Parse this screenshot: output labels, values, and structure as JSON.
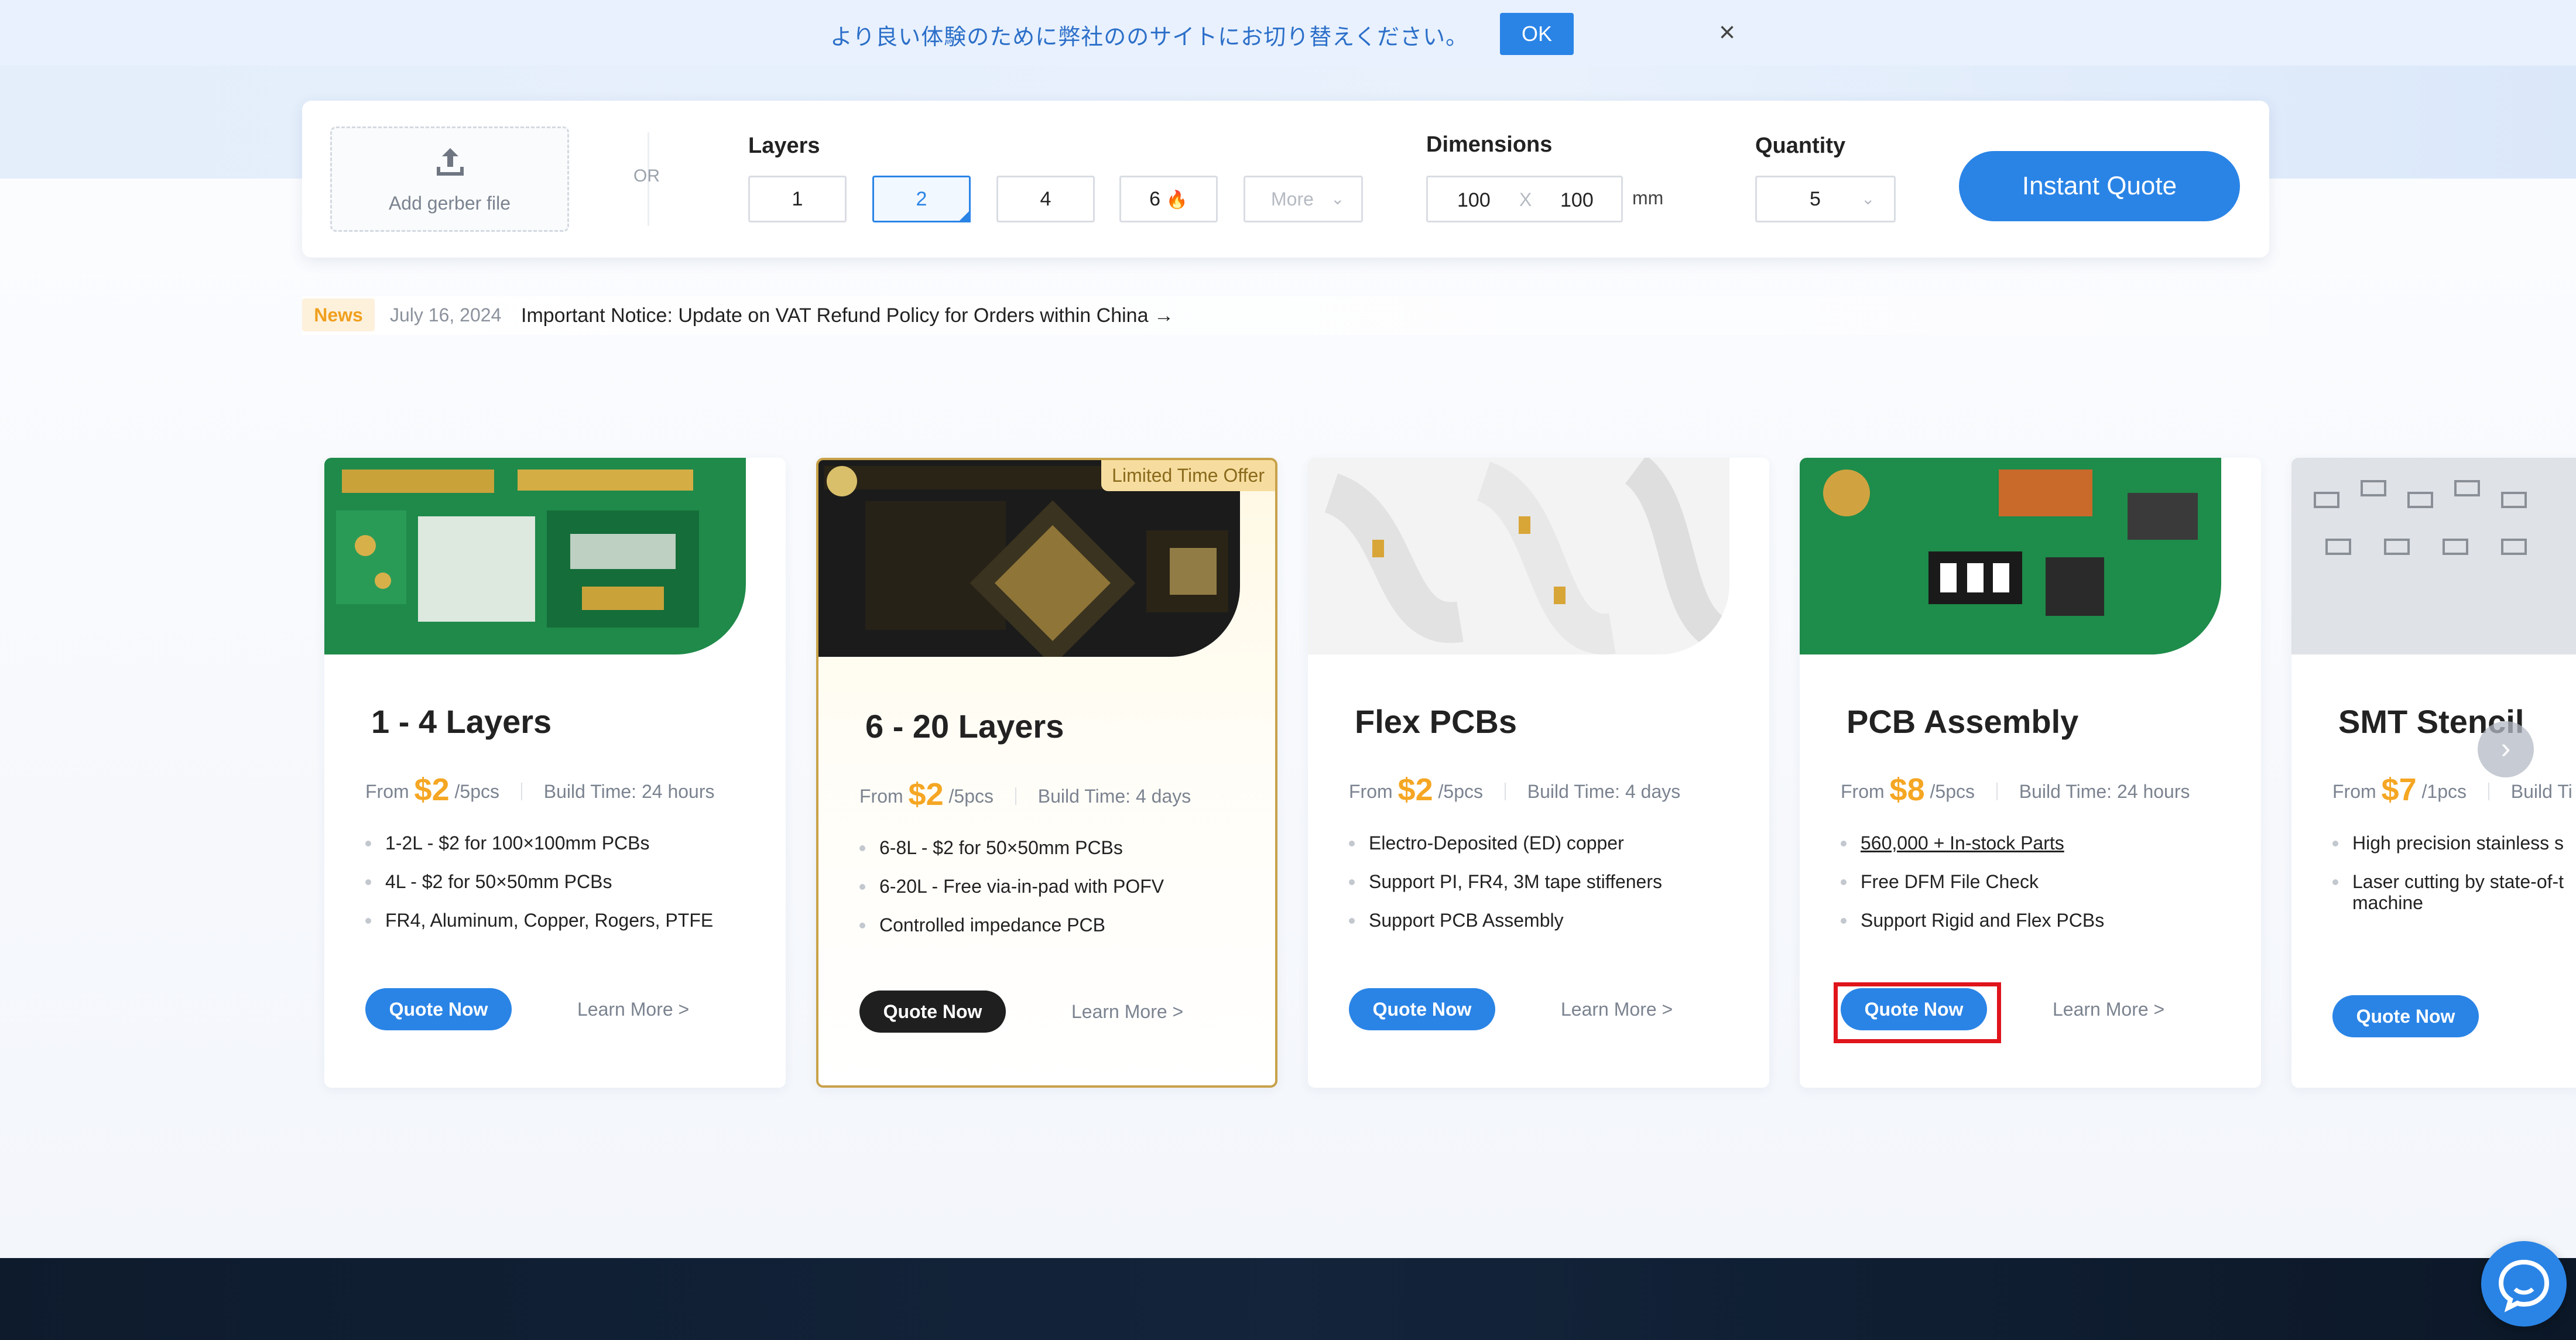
{
  "language_banner": {
    "message": "より良い体験のために弊社ののサイトにお切り替えください。",
    "ok_label": "OK",
    "close_icon": "×"
  },
  "quote_panel": {
    "upload_label": "Add gerber file",
    "or_label": "OR",
    "layers_title": "Layers",
    "layer_options": [
      "1",
      "2",
      "4",
      "6"
    ],
    "selected_layer": "2",
    "more_label": "More",
    "dimensions_title": "Dimensions",
    "dim_width": "100",
    "dim_separator": "X",
    "dim_height": "100",
    "dim_unit": "mm",
    "quantity_title": "Quantity",
    "quantity_value": "5",
    "instant_quote_label": "Instant Quote",
    "accent_color": "#2a84e6"
  },
  "news": {
    "badge": "News",
    "date": "July 16, 2024",
    "title": "Important Notice: Update on VAT Refund Policy for Orders within China →"
  },
  "cards": [
    {
      "title": "1 - 4 Layers",
      "from": "From",
      "price": "$2",
      "unit": "/5pcs",
      "build_time": "Build Time: 24 hours",
      "features": [
        "1-2L - $2 for 100×100mm PCBs",
        "4L - $2 for 50×50mm PCBs",
        "FR4, Aluminum, Copper, Rogers, PTFE"
      ],
      "quote_label": "Quote Now",
      "learn_label": "Learn More >"
    },
    {
      "title": "6 - 20 Layers",
      "tag": "Limited Time Offer",
      "from": "From",
      "price": "$2",
      "unit": "/5pcs",
      "build_time": "Build Time: 4 days",
      "features": [
        "6-8L - $2 for 50×50mm PCBs",
        "6-20L - Free via-in-pad with POFV",
        "Controlled impedance PCB"
      ],
      "quote_label": "Quote Now",
      "learn_label": "Learn More >"
    },
    {
      "title": "Flex PCBs",
      "from": "From",
      "price": "$2",
      "unit": "/5pcs",
      "build_time": "Build Time: 4 days",
      "features": [
        "Electro-Deposited (ED) copper",
        "Support PI, FR4, 3M tape stiffeners",
        "Support PCB Assembly"
      ],
      "quote_label": "Quote Now",
      "learn_label": "Learn More >"
    },
    {
      "title": "PCB Assembly",
      "from": "From",
      "price": "$8",
      "unit": "/5pcs",
      "build_time": "Build Time: 24 hours",
      "features": [
        "560,000 + In-stock Parts",
        "Free DFM File Check",
        "Support Rigid and Flex PCBs"
      ],
      "quote_label": "Quote Now",
      "learn_label": "Learn More >"
    },
    {
      "title": "SMT Stencil",
      "from": "From",
      "price": "$7",
      "unit": "/1pcs",
      "build_time": "Build Ti",
      "features": [
        "High precision stainless s",
        "Laser cutting by state-of-t machine"
      ],
      "quote_label": "Quote Now"
    }
  ]
}
